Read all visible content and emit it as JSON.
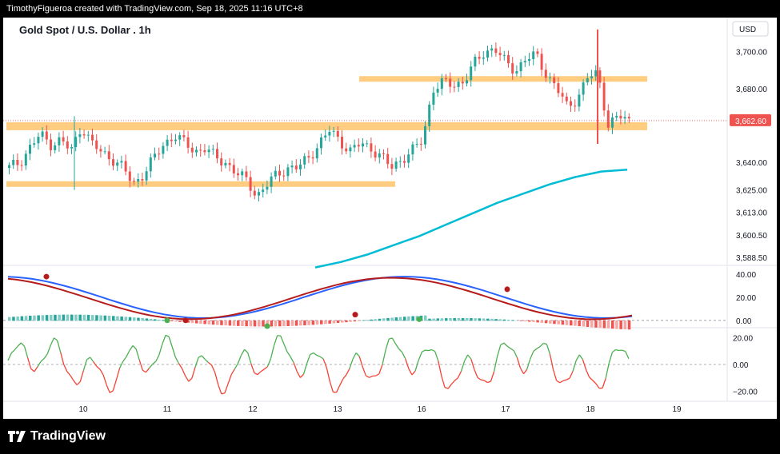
{
  "header": {
    "credit": "TimothyFigueroa created with TradingView.com, Sep 18, 2025 11:16 UTC+8"
  },
  "chart": {
    "title": "Gold Spot / U.S. Dollar . 1h",
    "currency": "USD",
    "price_label": "3,662.60",
    "price_ticks": [
      "3,700.00",
      "3,680.00",
      "3,640.00",
      "3,625.00",
      "3,613.00",
      "3,600.50",
      "3,588.50"
    ],
    "macd_ticks": [
      "40.00",
      "20.00",
      "0.00"
    ],
    "osc_ticks": [
      "20.00",
      "0.00",
      "−20.00"
    ],
    "x_ticks": [
      "10",
      "11",
      "12",
      "13",
      "16",
      "17",
      "18",
      "19"
    ],
    "colors": {
      "up": "#26a69a",
      "down": "#ef5350",
      "zone": "#ffcc80",
      "ma": "#00bcd4",
      "macd_fast": "#2962ff",
      "macd_slow": "#b71c1c",
      "macd_green": "#4caf50"
    }
  },
  "chart_data": {
    "type": "candlestick",
    "title": "Gold Spot / U.S. Dollar . 1h",
    "x_ticks": [
      "10",
      "11",
      "12",
      "13",
      "16",
      "17",
      "18",
      "19"
    ],
    "ylim": [
      3585,
      3715
    ],
    "close_path": [
      3637,
      3640,
      3648,
      3655,
      3650,
      3652,
      3646,
      3660,
      3650,
      3645,
      3642,
      3637,
      3628,
      3634,
      3642,
      3650,
      3655,
      3650,
      3646,
      3648,
      3642,
      3640,
      3634,
      3630,
      3622,
      3628,
      3634,
      3637,
      3637,
      3643,
      3650,
      3657,
      3652,
      3646,
      3650,
      3648,
      3643,
      3637,
      3642,
      3646,
      3652,
      3680,
      3683,
      3682,
      3684,
      3693,
      3700,
      3702,
      3694,
      3690,
      3696,
      3698,
      3688,
      3680,
      3670,
      3675,
      3686,
      3688,
      3660,
      3665,
      3662.6
    ],
    "ma_path": [
      3583,
      3586,
      3590,
      3595,
      3600,
      3606,
      3612,
      3618,
      3623,
      3628,
      3632,
      3635,
      3636
    ],
    "zones": [
      {
        "label": "resistance",
        "price": 3685
      },
      {
        "label": "support",
        "price": 3660
      },
      {
        "label": "support-low",
        "price": 3628
      }
    ],
    "last_price": 3662.6,
    "macd_range": [
      -5,
      45
    ],
    "osc_range": [
      -25,
      25
    ]
  },
  "footer": {
    "logo_text": "TradingView"
  }
}
